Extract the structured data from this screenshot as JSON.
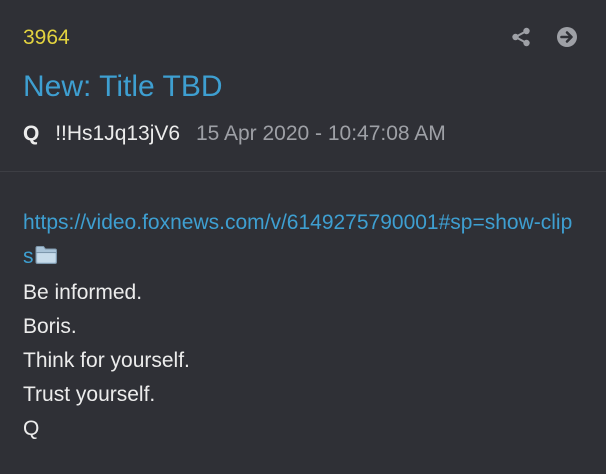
{
  "post": {
    "number": "3964",
    "title": "New: Title TBD",
    "author": "Q",
    "tripcode": "!!Hs1Jq13jV6",
    "timestamp": "15 Apr 2020 - 10:47:08 AM",
    "link": "https://video.foxnews.com/v/6149275790001#sp=show-clips",
    "lines": [
      "Be informed.",
      "Boris.",
      "Think for yourself.",
      "Trust yourself.",
      "Q"
    ]
  },
  "icons": {
    "share": "share-icon",
    "goto": "arrow-circle-right-icon",
    "folder": "folder-icon"
  },
  "colors": {
    "background": "#2f3036",
    "post_number": "#e3d33f",
    "title_link": "#3e9fd1",
    "text": "#ececec",
    "muted": "#9ea0a6"
  }
}
